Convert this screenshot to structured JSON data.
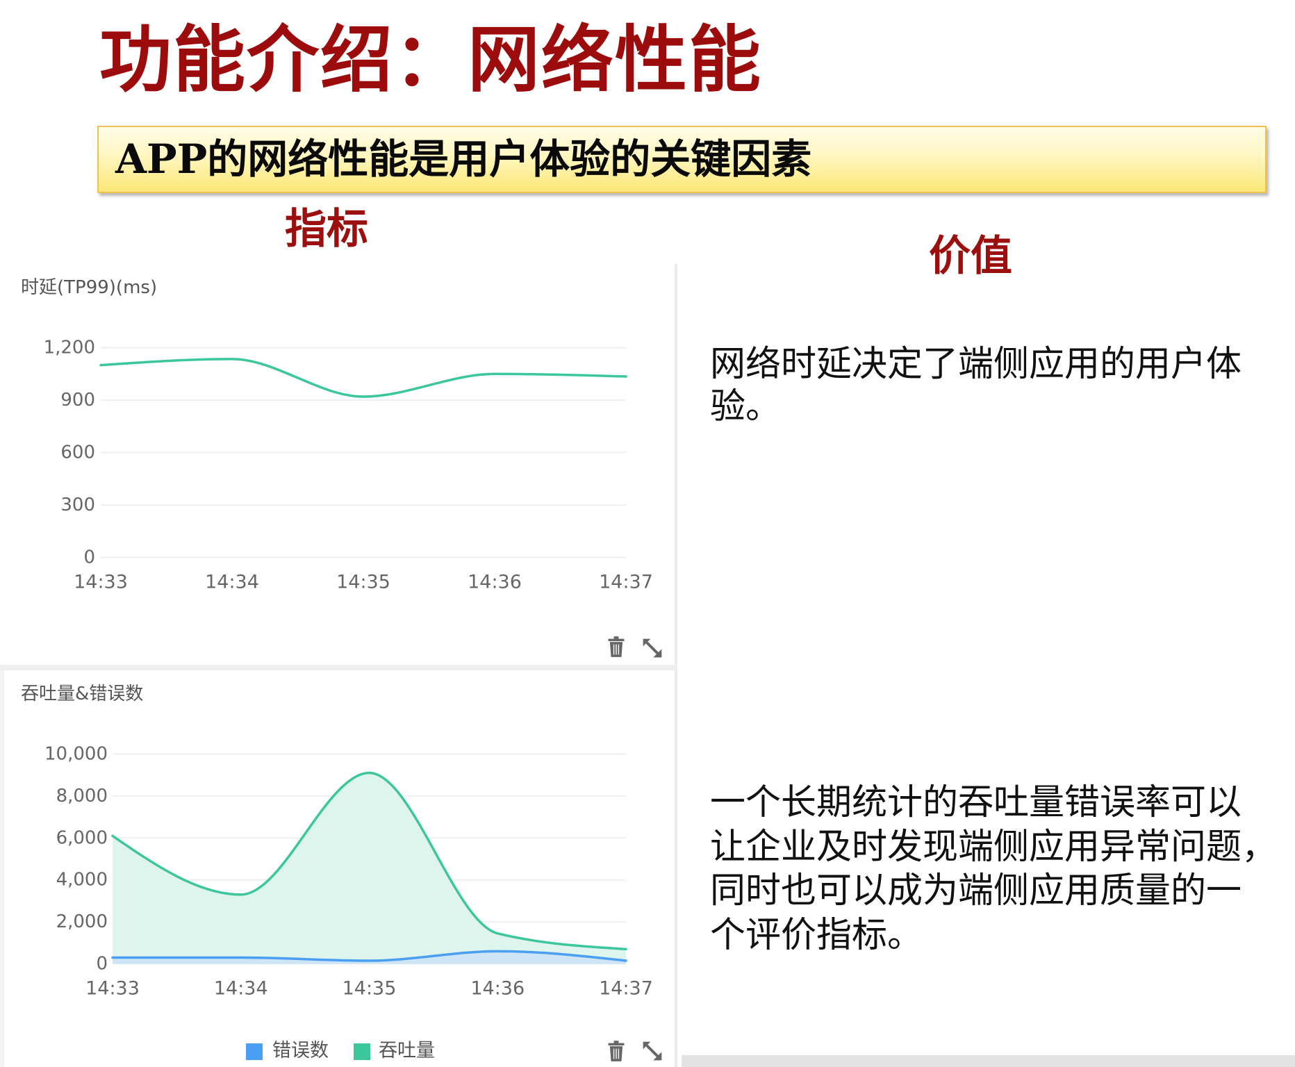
{
  "slide": {
    "title": "功能介绍：网络性能",
    "banner": "APP的网络性能是用户体验的关键因素",
    "metrics_heading": "指标",
    "value_heading": "价值",
    "latency_value_text": "网络时延决定了端侧应用的用户体\n验。",
    "throughput_value_text": "一个长期统计的吞吐量错误率可以\n让企业及时发现端侧应用异常问题，\n同时也可以成为端侧应用质量的一\n个评价指标。"
  },
  "icons": {
    "delete": "trash-icon",
    "expand": "expand-icon"
  },
  "colors": {
    "title": "#9c0c0c",
    "heading": "#9b0f0f",
    "banner_border": "#f1c153",
    "banner_fill": "#fff6c0",
    "gridline": "#ebebeb",
    "tick_text": "#666666",
    "icon": "#666666"
  },
  "chart_data": [
    {
      "type": "line",
      "title": "时延(TP99)(ms)",
      "categories": [
        "14:33",
        "14:34",
        "14:35",
        "14:36",
        "14:37"
      ],
      "series": [
        {
          "values": [
            1100,
            1135,
            920,
            1050,
            1035
          ],
          "color": "#3cc69c"
        }
      ],
      "yticks": [
        0,
        300,
        600,
        900,
        1200
      ],
      "ytick_labels": [
        "0",
        "300",
        "600",
        "900",
        "1,200"
      ],
      "ylim": [
        0,
        1200
      ],
      "smooth": true,
      "grid": true,
      "legend": "none"
    },
    {
      "type": "area",
      "title": "吞吐量&错误数",
      "categories": [
        "14:33",
        "14:34",
        "14:35",
        "14:36",
        "14:37"
      ],
      "series": [
        {
          "name": "错误数",
          "values": [
            300,
            300,
            150,
            600,
            150
          ],
          "color": "#4a9ff2",
          "fill": "#cde5f7"
        },
        {
          "name": "吞吐量",
          "values": [
            6100,
            3300,
            9100,
            1450,
            700
          ],
          "color": "#3cc69c",
          "fill": "#def5ed"
        }
      ],
      "yticks": [
        0,
        2000,
        4000,
        6000,
        8000,
        10000
      ],
      "ytick_labels": [
        "0",
        "2,000",
        "4,000",
        "6,000",
        "8,000",
        "10,000"
      ],
      "ylim": [
        0,
        10000
      ],
      "smooth": true,
      "grid": true,
      "legend": "bottom"
    }
  ]
}
